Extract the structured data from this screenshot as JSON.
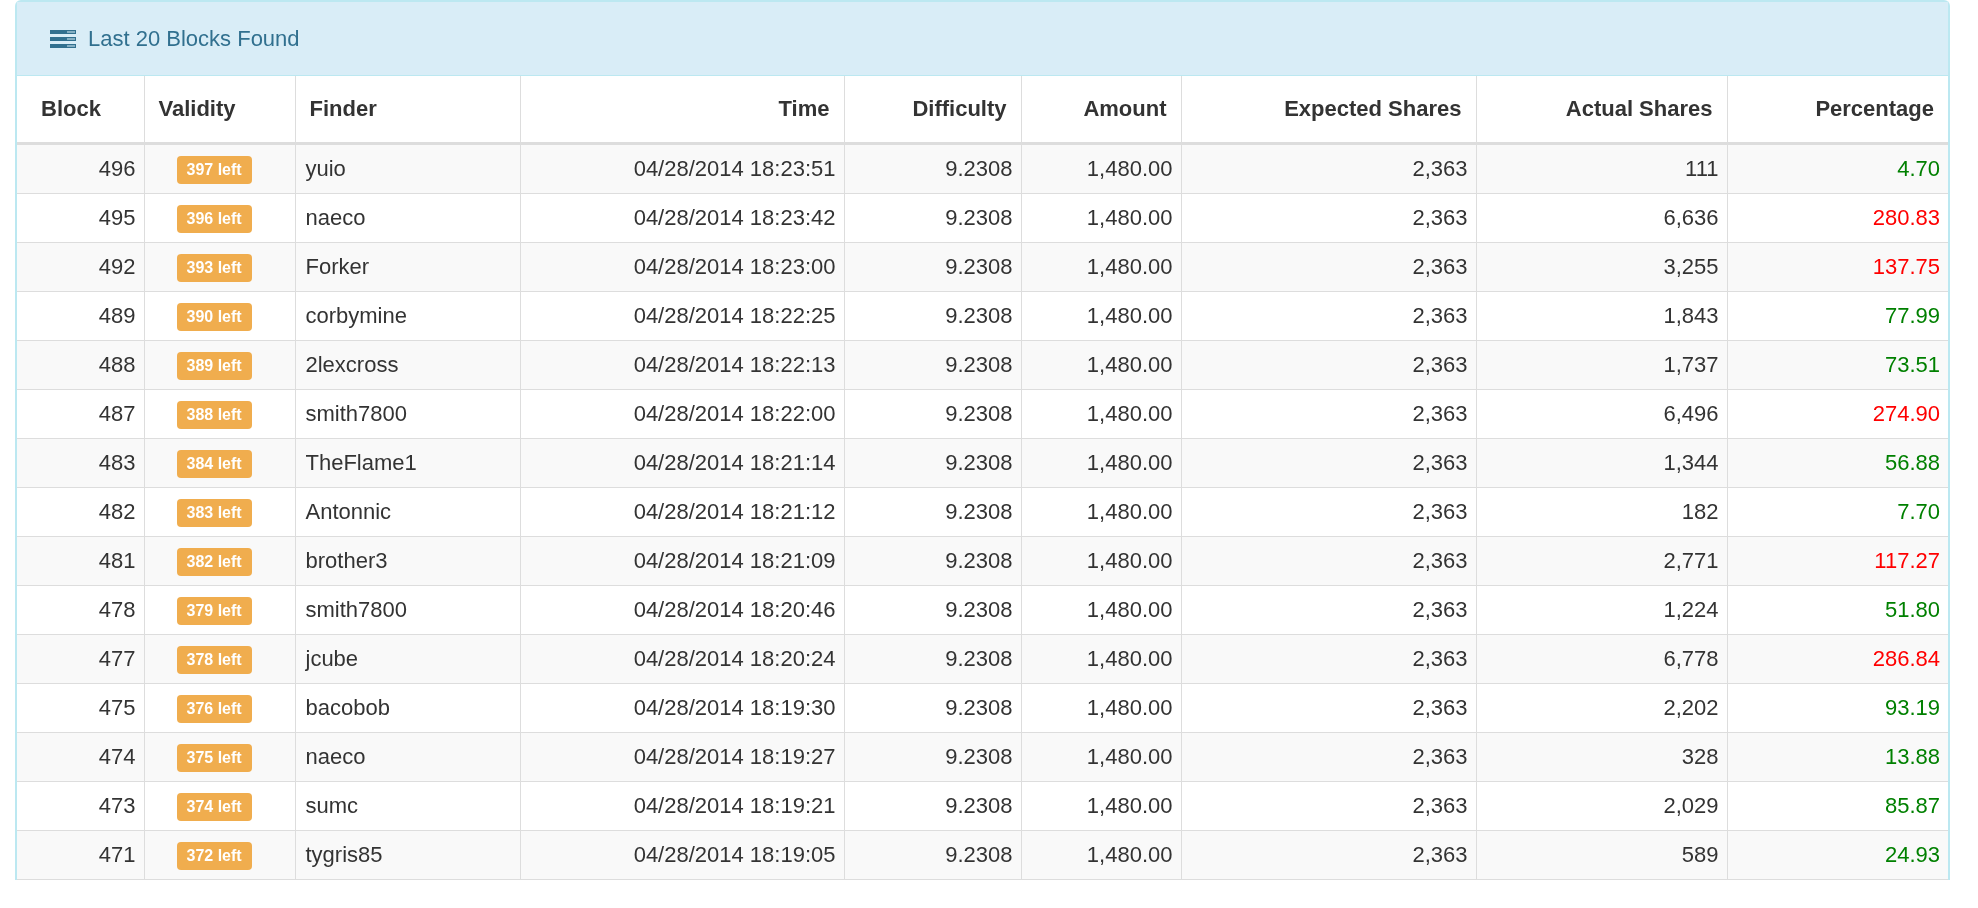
{
  "panel": {
    "title": "Last 20 Blocks Found"
  },
  "table": {
    "columns": [
      "Block",
      "Validity",
      "Finder",
      "Time",
      "Difficulty",
      "Amount",
      "Expected Shares",
      "Actual Shares",
      "Percentage"
    ],
    "rows": [
      {
        "block": "496",
        "validity": "397 left",
        "finder": "yuio",
        "time": "04/28/2014 18:23:51",
        "difficulty": "9.2308",
        "amount": "1,480.00",
        "expected": "2,363",
        "actual": "111",
        "percentage": {
          "text": "4.70",
          "color": "#008000"
        }
      },
      {
        "block": "495",
        "validity": "396 left",
        "finder": "naeco",
        "time": "04/28/2014 18:23:42",
        "difficulty": "9.2308",
        "amount": "1,480.00",
        "expected": "2,363",
        "actual": "6,636",
        "percentage": {
          "text": "280.83",
          "color": "#ff0000"
        }
      },
      {
        "block": "492",
        "validity": "393 left",
        "finder": "Forker",
        "time": "04/28/2014 18:23:00",
        "difficulty": "9.2308",
        "amount": "1,480.00",
        "expected": "2,363",
        "actual": "3,255",
        "percentage": {
          "text": "137.75",
          "color": "#ff0000"
        }
      },
      {
        "block": "489",
        "validity": "390 left",
        "finder": "corbymine",
        "time": "04/28/2014 18:22:25",
        "difficulty": "9.2308",
        "amount": "1,480.00",
        "expected": "2,363",
        "actual": "1,843",
        "percentage": {
          "text": "77.99",
          "color": "#008000"
        }
      },
      {
        "block": "488",
        "validity": "389 left",
        "finder": "2lexcross",
        "time": "04/28/2014 18:22:13",
        "difficulty": "9.2308",
        "amount": "1,480.00",
        "expected": "2,363",
        "actual": "1,737",
        "percentage": {
          "text": "73.51",
          "color": "#008000"
        }
      },
      {
        "block": "487",
        "validity": "388 left",
        "finder": "smith7800",
        "time": "04/28/2014 18:22:00",
        "difficulty": "9.2308",
        "amount": "1,480.00",
        "expected": "2,363",
        "actual": "6,496",
        "percentage": {
          "text": "274.90",
          "color": "#ff0000"
        }
      },
      {
        "block": "483",
        "validity": "384 left",
        "finder": "TheFlame1",
        "time": "04/28/2014 18:21:14",
        "difficulty": "9.2308",
        "amount": "1,480.00",
        "expected": "2,363",
        "actual": "1,344",
        "percentage": {
          "text": "56.88",
          "color": "#008000"
        }
      },
      {
        "block": "482",
        "validity": "383 left",
        "finder": "Antonnic",
        "time": "04/28/2014 18:21:12",
        "difficulty": "9.2308",
        "amount": "1,480.00",
        "expected": "2,363",
        "actual": "182",
        "percentage": {
          "text": "7.70",
          "color": "#008000"
        }
      },
      {
        "block": "481",
        "validity": "382 left",
        "finder": "brother3",
        "time": "04/28/2014 18:21:09",
        "difficulty": "9.2308",
        "amount": "1,480.00",
        "expected": "2,363",
        "actual": "2,771",
        "percentage": {
          "text": "117.27",
          "color": "#ff0000"
        }
      },
      {
        "block": "478",
        "validity": "379 left",
        "finder": "smith7800",
        "time": "04/28/2014 18:20:46",
        "difficulty": "9.2308",
        "amount": "1,480.00",
        "expected": "2,363",
        "actual": "1,224",
        "percentage": {
          "text": "51.80",
          "color": "#008000"
        }
      },
      {
        "block": "477",
        "validity": "378 left",
        "finder": "jcube",
        "time": "04/28/2014 18:20:24",
        "difficulty": "9.2308",
        "amount": "1,480.00",
        "expected": "2,363",
        "actual": "6,778",
        "percentage": {
          "text": "286.84",
          "color": "#ff0000"
        }
      },
      {
        "block": "475",
        "validity": "376 left",
        "finder": "bacobob",
        "time": "04/28/2014 18:19:30",
        "difficulty": "9.2308",
        "amount": "1,480.00",
        "expected": "2,363",
        "actual": "2,202",
        "percentage": {
          "text": "93.19",
          "color": "#008000"
        }
      },
      {
        "block": "474",
        "validity": "375 left",
        "finder": "naeco",
        "time": "04/28/2014 18:19:27",
        "difficulty": "9.2308",
        "amount": "1,480.00",
        "expected": "2,363",
        "actual": "328",
        "percentage": {
          "text": "13.88",
          "color": "#008000"
        }
      },
      {
        "block": "473",
        "validity": "374 left",
        "finder": "sumc",
        "time": "04/28/2014 18:19:21",
        "difficulty": "9.2308",
        "amount": "1,480.00",
        "expected": "2,363",
        "actual": "2,029",
        "percentage": {
          "text": "85.87",
          "color": "#008000"
        }
      },
      {
        "block": "471",
        "validity": "372 left",
        "finder": "tygris85",
        "time": "04/28/2014 18:19:05",
        "difficulty": "9.2308",
        "amount": "1,480.00",
        "expected": "2,363",
        "actual": "589",
        "percentage": {
          "text": "24.93",
          "color": "#008000"
        }
      }
    ]
  }
}
